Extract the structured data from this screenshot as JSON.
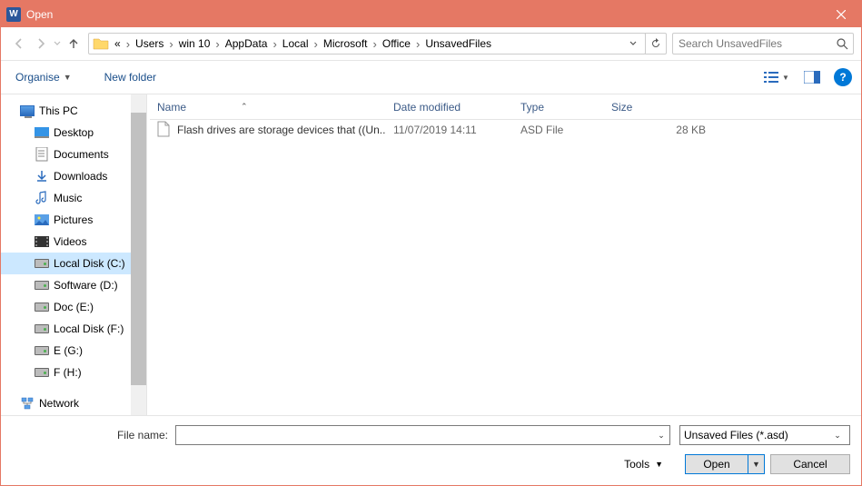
{
  "title": "Open",
  "breadcrumbs": {
    "overflow": "«",
    "items": [
      "Users",
      "win 10",
      "AppData",
      "Local",
      "Microsoft",
      "Office",
      "UnsavedFiles"
    ]
  },
  "search": {
    "placeholder": "Search UnsavedFiles"
  },
  "toolbar": {
    "organise": "Organise",
    "new_folder": "New folder"
  },
  "tree": {
    "this_pc": "This PC",
    "items": [
      {
        "label": "Desktop"
      },
      {
        "label": "Documents"
      },
      {
        "label": "Downloads"
      },
      {
        "label": "Music"
      },
      {
        "label": "Pictures"
      },
      {
        "label": "Videos"
      },
      {
        "label": "Local Disk (C:)",
        "selected": true
      },
      {
        "label": "Software (D:)"
      },
      {
        "label": "Doc (E:)"
      },
      {
        "label": "Local Disk (F:)"
      },
      {
        "label": "E (G:)"
      },
      {
        "label": "F (H:)"
      }
    ],
    "network": "Network"
  },
  "columns": {
    "name": "Name",
    "date": "Date modified",
    "type": "Type",
    "size": "Size"
  },
  "files": [
    {
      "name": "Flash drives are storage devices that ((Un...",
      "date": "11/07/2019 14:11",
      "type": "ASD File",
      "size": "28 KB"
    }
  ],
  "bottom": {
    "filename_label": "File name:",
    "filename_value": "",
    "type_filter": "Unsaved Files (*.asd)",
    "tools": "Tools",
    "open": "Open",
    "cancel": "Cancel"
  }
}
